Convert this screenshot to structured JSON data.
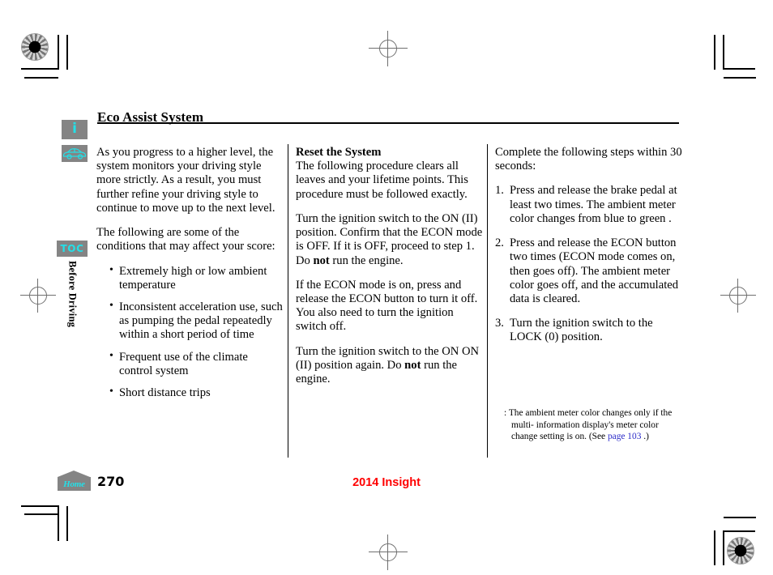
{
  "document": {
    "title": "Eco Assist System",
    "section_tab": "Before Driving",
    "toc_label": "TOC",
    "info_icon_glyph": "i",
    "car_icon_name": "vehicle side view"
  },
  "columns": {
    "left": {
      "paragraph_1": "As you progress to a higher level, the system monitors your driving style more strictly. As a result, you must further refine your driving style to continue to move up to the next level.",
      "paragraph_2": "The following are some of the conditions that may affect your score:",
      "bullets": [
        "Extremely high or low ambient temperature",
        "Inconsistent acceleration use, such as pumping the pedal repeatedly within a short period of time",
        "Frequent use of the climate control system",
        "Short distance trips"
      ]
    },
    "middle": {
      "heading": "Reset the System",
      "paragraph_1": "The following procedure clears all leaves and your lifetime points. This procedure must be followed exactly.",
      "paragraph_2_a": "Turn the ignition switch to the ON (II) position. Confirm that the ECON mode is OFF. If it is OFF, proceed to step 1. Do ",
      "paragraph_2_bold": "not",
      "paragraph_2_b": " run the engine.",
      "paragraph_3": "If the ECON mode is on, press and release the ECON button to turn it off. You also need to turn the ignition switch off.",
      "paragraph_4_a": "Turn the ignition switch to the ON ON (II) position again. Do ",
      "paragraph_4_bold": "not",
      "paragraph_4_b": " run the engine."
    },
    "right": {
      "intro": "Complete the following steps within 30 seconds:",
      "steps": [
        "Press and release the brake pedal at least two times. The ambient meter color changes from blue to green .",
        "Press and release the ECON button two times (ECON mode comes on, then goes off). The ambient meter color goes off, and the accumulated data is cleared.",
        "Turn the ignition switch to the LOCK (0) position."
      ],
      "footnote_marker": ":",
      "footnote_a": "The ambient meter color  changes only if the multi- information display's meter  color change setting is on. (See ",
      "footnote_link": "page 103",
      "footnote_b": " .)"
    }
  },
  "footer": {
    "home_label": "Home",
    "page_number": "270",
    "model": "2014 Insight"
  },
  "colors": {
    "accent_cyan": "#23e0e8",
    "chip_gray": "#848484",
    "link_blue": "#2b2bc8",
    "model_red": "#ff0000"
  }
}
